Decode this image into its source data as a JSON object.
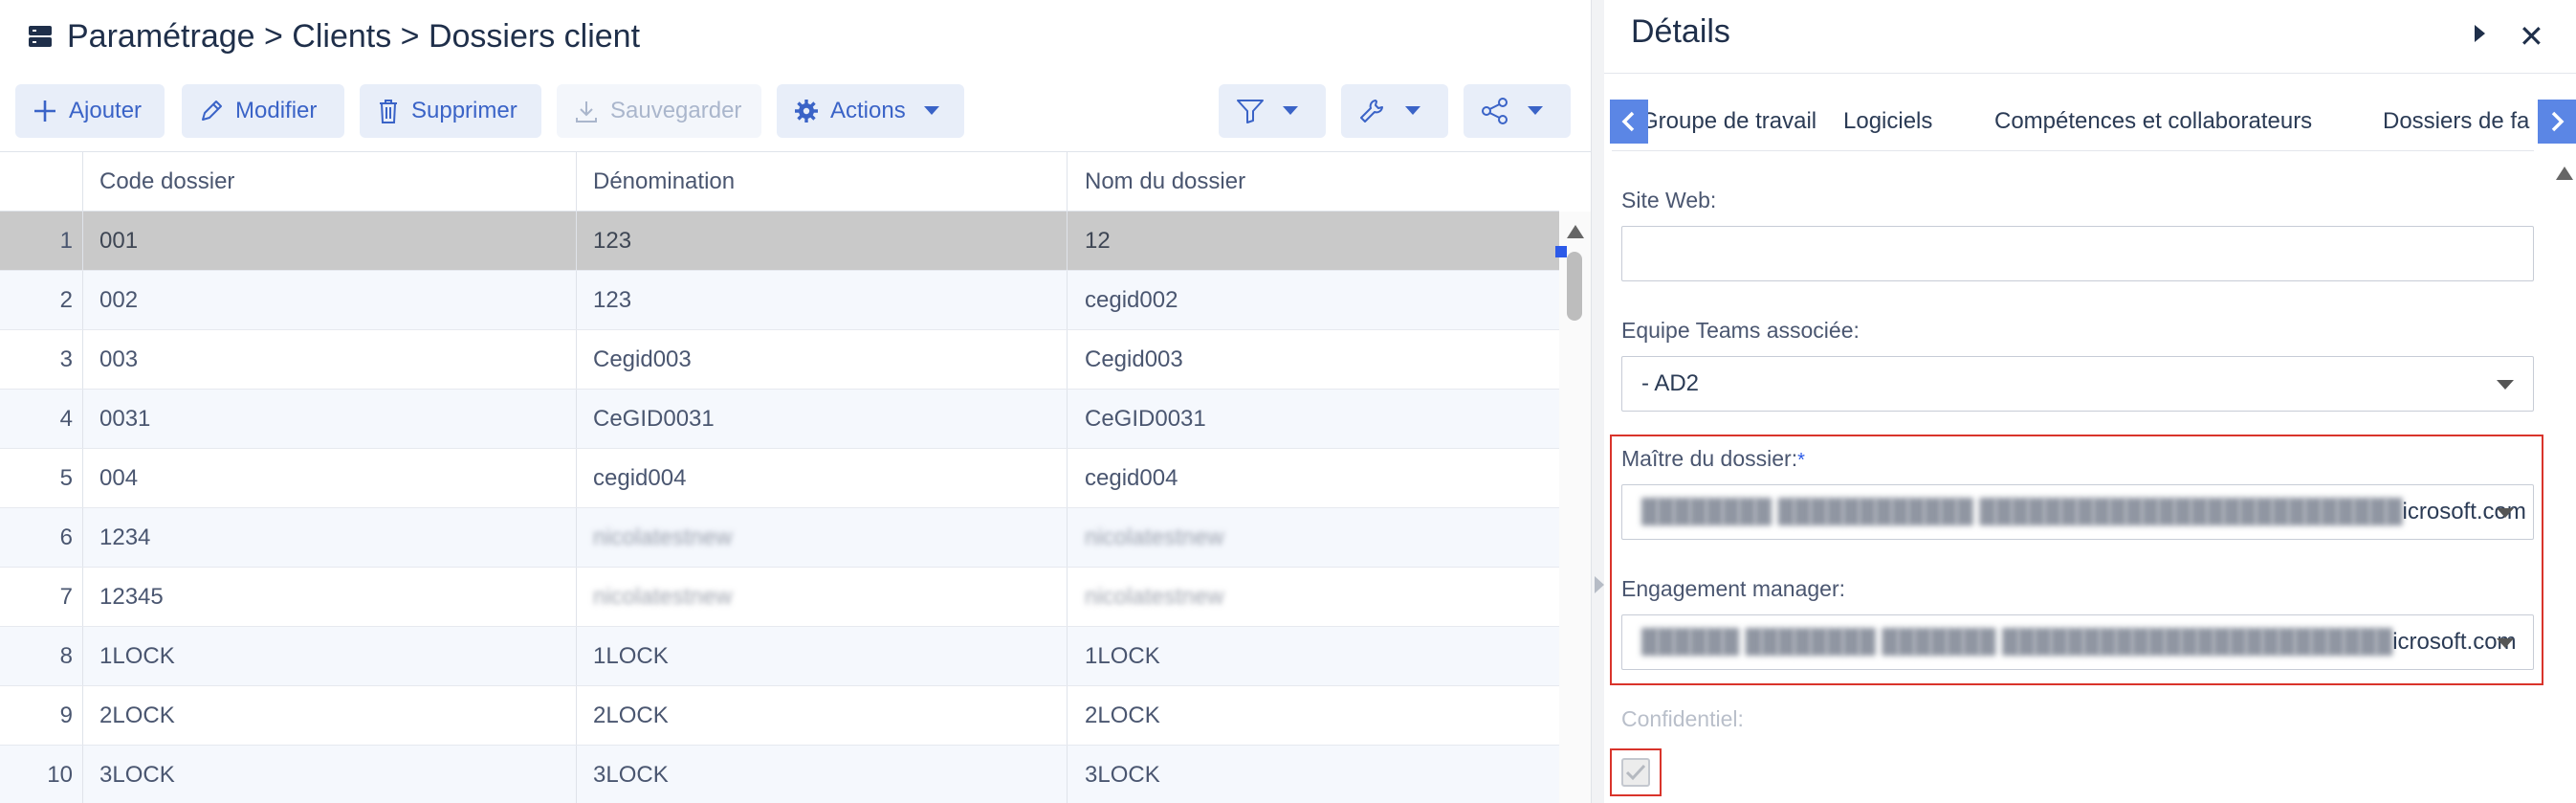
{
  "breadcrumb": "Paramétrage > Clients > Dossiers client",
  "toolbar": {
    "add": "Ajouter",
    "edit": "Modifier",
    "delete": "Supprimer",
    "save": "Sauvegarder",
    "actions": "Actions"
  },
  "grid": {
    "columns": [
      "Code dossier",
      "Dénomination",
      "Nom du dossier"
    ],
    "rows": [
      {
        "n": "1",
        "code": "001",
        "denom": "123",
        "nom": "12"
      },
      {
        "n": "2",
        "code": "002",
        "denom": "123",
        "nom": "cegid002"
      },
      {
        "n": "3",
        "code": "003",
        "denom": "Cegid003",
        "nom": "Cegid003"
      },
      {
        "n": "4",
        "code": "0031",
        "denom": "CeGID0031",
        "nom": "CeGID0031"
      },
      {
        "n": "5",
        "code": "004",
        "denom": "cegid004",
        "nom": "cegid004"
      },
      {
        "n": "6",
        "code": "1234",
        "denom": "nicolatestnew",
        "nom": "nicolatestnew"
      },
      {
        "n": "7",
        "code": "12345",
        "denom": "nicolatestnew",
        "nom": "nicolatestnew"
      },
      {
        "n": "8",
        "code": "1LOCK",
        "denom": "1LOCK",
        "nom": "1LOCK"
      },
      {
        "n": "9",
        "code": "2LOCK",
        "denom": "2LOCK",
        "nom": "2LOCK"
      },
      {
        "n": "10",
        "code": "3LOCK",
        "denom": "3LOCK",
        "nom": "3LOCK"
      }
    ]
  },
  "details": {
    "title": "Détails",
    "tabs": [
      "Groupe de travail",
      "Logiciels",
      "Compétences et collaborateurs",
      "Dossiers de fa"
    ],
    "fields": {
      "site_web_label": "Site Web:",
      "site_web_value": "",
      "teams_label": "Equipe Teams associée:",
      "teams_value": "- AD2",
      "maitre_label": "Maître du dossier:",
      "maitre_required": "*",
      "maitre_value_visible": "icrosoft.com",
      "engagement_label": "Engagement manager:",
      "engagement_value_visible": "icrosoft.com",
      "confidentiel_label": "Confidentiel:"
    }
  }
}
